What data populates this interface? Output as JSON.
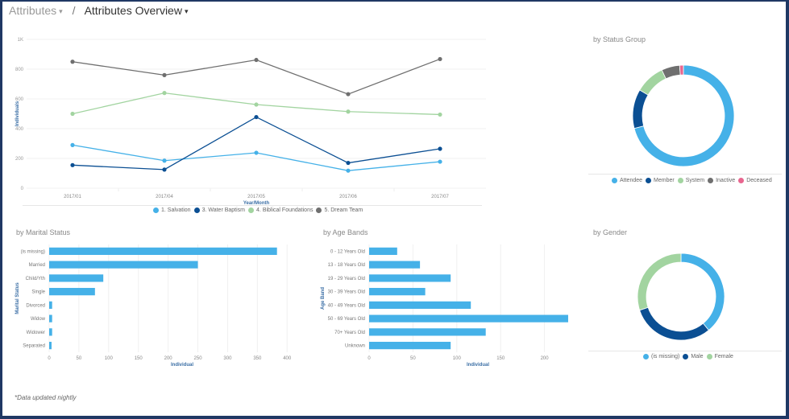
{
  "breadcrumb": {
    "parent": "Attributes",
    "separator": "/",
    "current": "Attributes Overview",
    "caret": "▾"
  },
  "footer_note": "*Data updated nightly",
  "colors": {
    "light_blue": "#45b1e8",
    "dark_blue": "#0b4f93",
    "green": "#a2d4a0",
    "gray": "#6f6f6f",
    "pink": "#e8668f"
  },
  "chart_data": [
    {
      "id": "trend",
      "type": "line",
      "title": "",
      "xlabel": "Year/Month",
      "ylabel": "Individuals",
      "x": [
        "2017/01",
        "2017/04",
        "2017/05",
        "2017/06",
        "2017/07"
      ],
      "ylim": [
        0,
        1000
      ],
      "yticks": [
        0,
        200,
        400,
        600,
        800,
        1000
      ],
      "ytick_labels": [
        "0",
        "200",
        "400",
        "600",
        "800",
        "1K"
      ],
      "grid": true,
      "legend": "bottom",
      "series": [
        {
          "name": "1. Salvation",
          "color": "#45b1e8",
          "values": [
            290,
            185,
            238,
            118,
            178
          ]
        },
        {
          "name": "3. Water Baptism",
          "color": "#0b4f93",
          "values": [
            155,
            125,
            478,
            170,
            265
          ]
        },
        {
          "name": "4. Biblical Foundations",
          "color": "#a2d4a0",
          "values": [
            500,
            640,
            562,
            515,
            495
          ]
        },
        {
          "name": "5. Dream Team",
          "color": "#6f6f6f",
          "values": [
            850,
            760,
            862,
            632,
            868
          ]
        }
      ]
    },
    {
      "id": "status",
      "type": "pie",
      "title": "by Status Group",
      "donut": true,
      "legend": "bottom",
      "categories": [
        "Attendee",
        "Member",
        "System",
        "Inactive",
        "Deceased"
      ],
      "values": [
        71,
        12.5,
        9.5,
        5.8,
        1.2
      ],
      "colors": [
        "#45b1e8",
        "#0b4f93",
        "#a2d4a0",
        "#6f6f6f",
        "#e8668f"
      ]
    },
    {
      "id": "marital",
      "type": "bar",
      "orientation": "horizontal",
      "title": "by Marital Status",
      "xlabel": "Individual",
      "ylabel": "Marital Status",
      "categories": [
        "(is missing)",
        "Married",
        "Child/Yth",
        "Single",
        "Divorced",
        "Widow",
        "Widower",
        "Separated"
      ],
      "values": [
        383,
        250,
        91,
        77,
        5,
        5,
        5,
        4
      ],
      "xlim": [
        0,
        420
      ],
      "xticks": [
        0,
        50,
        100,
        150,
        200,
        250,
        300,
        350,
        400
      ],
      "grid": true,
      "color": "#45b1e8"
    },
    {
      "id": "age",
      "type": "bar",
      "orientation": "horizontal",
      "title": "by Age Bands",
      "xlabel": "Individual",
      "ylabel": "Age Band",
      "categories": [
        "0 - 12 Years Old",
        "13 - 18 Years Old",
        "19 - 29 Years Old",
        "30 - 39 Years Old",
        "40 - 49 Years Old",
        "50 - 69 Years Old",
        "70+ Years Old",
        "Unknown"
      ],
      "values": [
        32,
        58,
        93,
        64,
        116,
        227,
        133,
        93
      ],
      "xlim": [
        0,
        250
      ],
      "xticks": [
        0,
        50,
        100,
        150,
        200
      ],
      "grid": true,
      "color": "#45b1e8"
    },
    {
      "id": "gender",
      "type": "pie",
      "title": "by Gender",
      "donut": true,
      "legend": "bottom",
      "categories": [
        "(is missing)",
        "Male",
        "Female"
      ],
      "values": [
        39,
        31,
        30
      ],
      "colors": [
        "#45b1e8",
        "#0b4f93",
        "#a2d4a0"
      ]
    }
  ]
}
